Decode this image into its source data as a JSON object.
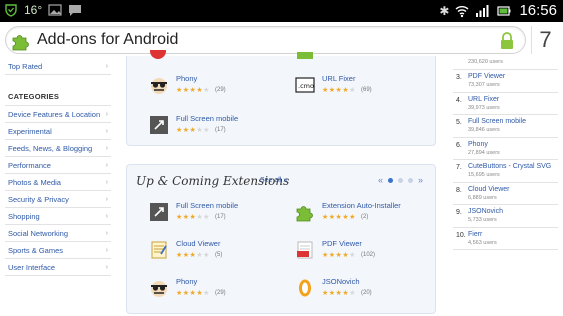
{
  "status_bar": {
    "temperature": "16°",
    "time": "16:56",
    "icons": [
      "shield-icon",
      "image-icon",
      "message-icon",
      "bluetooth-icon",
      "wifi-icon",
      "signal-icon",
      "battery-icon"
    ]
  },
  "url_bar": {
    "title": "Add-ons for Android",
    "tab_count": "7",
    "colors": {
      "puzzle": "#7cbd37",
      "lock": "#8cc63e"
    }
  },
  "sidebar": {
    "top_rated": "Top Rated",
    "categories_heading": "CATEGORIES",
    "categories": [
      "Device Features & Location",
      "Experimental",
      "Feeds, News, & Blogging",
      "Performance",
      "Photos & Media",
      "Security & Privacy",
      "Shopping",
      "Social Networking",
      "Sports & Games",
      "User Interface"
    ]
  },
  "featured_partial": [
    {
      "name": "Phony",
      "rating": 4,
      "count": "(29)",
      "icon": "spy-face-icon"
    },
    {
      "name": "URL Fixer",
      "rating": 4,
      "count": "(69)",
      "icon": "cmo-icon"
    },
    {
      "name": "Full Screen mobile",
      "rating": 3,
      "count": "(17)",
      "icon": "fullscreen-icon"
    }
  ],
  "upcoming": {
    "title": "Up & Coming Extensions",
    "see_all": "See all »",
    "prev": "«",
    "next": "»",
    "items": [
      {
        "name": "Full Screen mobile",
        "rating": 3,
        "count": "(17)",
        "icon": "fullscreen-icon"
      },
      {
        "name": "Extension Auto-Installer",
        "rating": 5,
        "count": "(2)",
        "icon": "puzzle-icon"
      },
      {
        "name": "Cloud Viewer",
        "rating": 3,
        "count": "(5)",
        "icon": "cloud-viewer-icon"
      },
      {
        "name": "PDF Viewer",
        "rating": 4,
        "count": "(102)",
        "icon": "pdf-icon"
      },
      {
        "name": "Phony",
        "rating": 4,
        "count": "(29)",
        "icon": "spy-face-icon"
      },
      {
        "name": "JSONovich",
        "rating": 4,
        "count": "(20)",
        "icon": "jsonovich-icon"
      }
    ]
  },
  "popular": {
    "first_users": "230,620 users",
    "items": [
      {
        "num": "3.",
        "name": "PDF Viewer",
        "users": "73,307 users"
      },
      {
        "num": "4.",
        "name": "URL Fixer",
        "users": "39,973 users"
      },
      {
        "num": "5.",
        "name": "Full Screen mobile",
        "users": "39,846 users"
      },
      {
        "num": "6.",
        "name": "Phony",
        "users": "27,894 users"
      },
      {
        "num": "7.",
        "name": "CuteButtons - Crystal SVG",
        "users": "15,695 users"
      },
      {
        "num": "8.",
        "name": "Cloud Viewer",
        "users": "6,889 users"
      },
      {
        "num": "9.",
        "name": "JSONovich",
        "users": "5,733 users"
      },
      {
        "num": "10.",
        "name": "Fierr",
        "users": "4,563 users"
      }
    ]
  }
}
